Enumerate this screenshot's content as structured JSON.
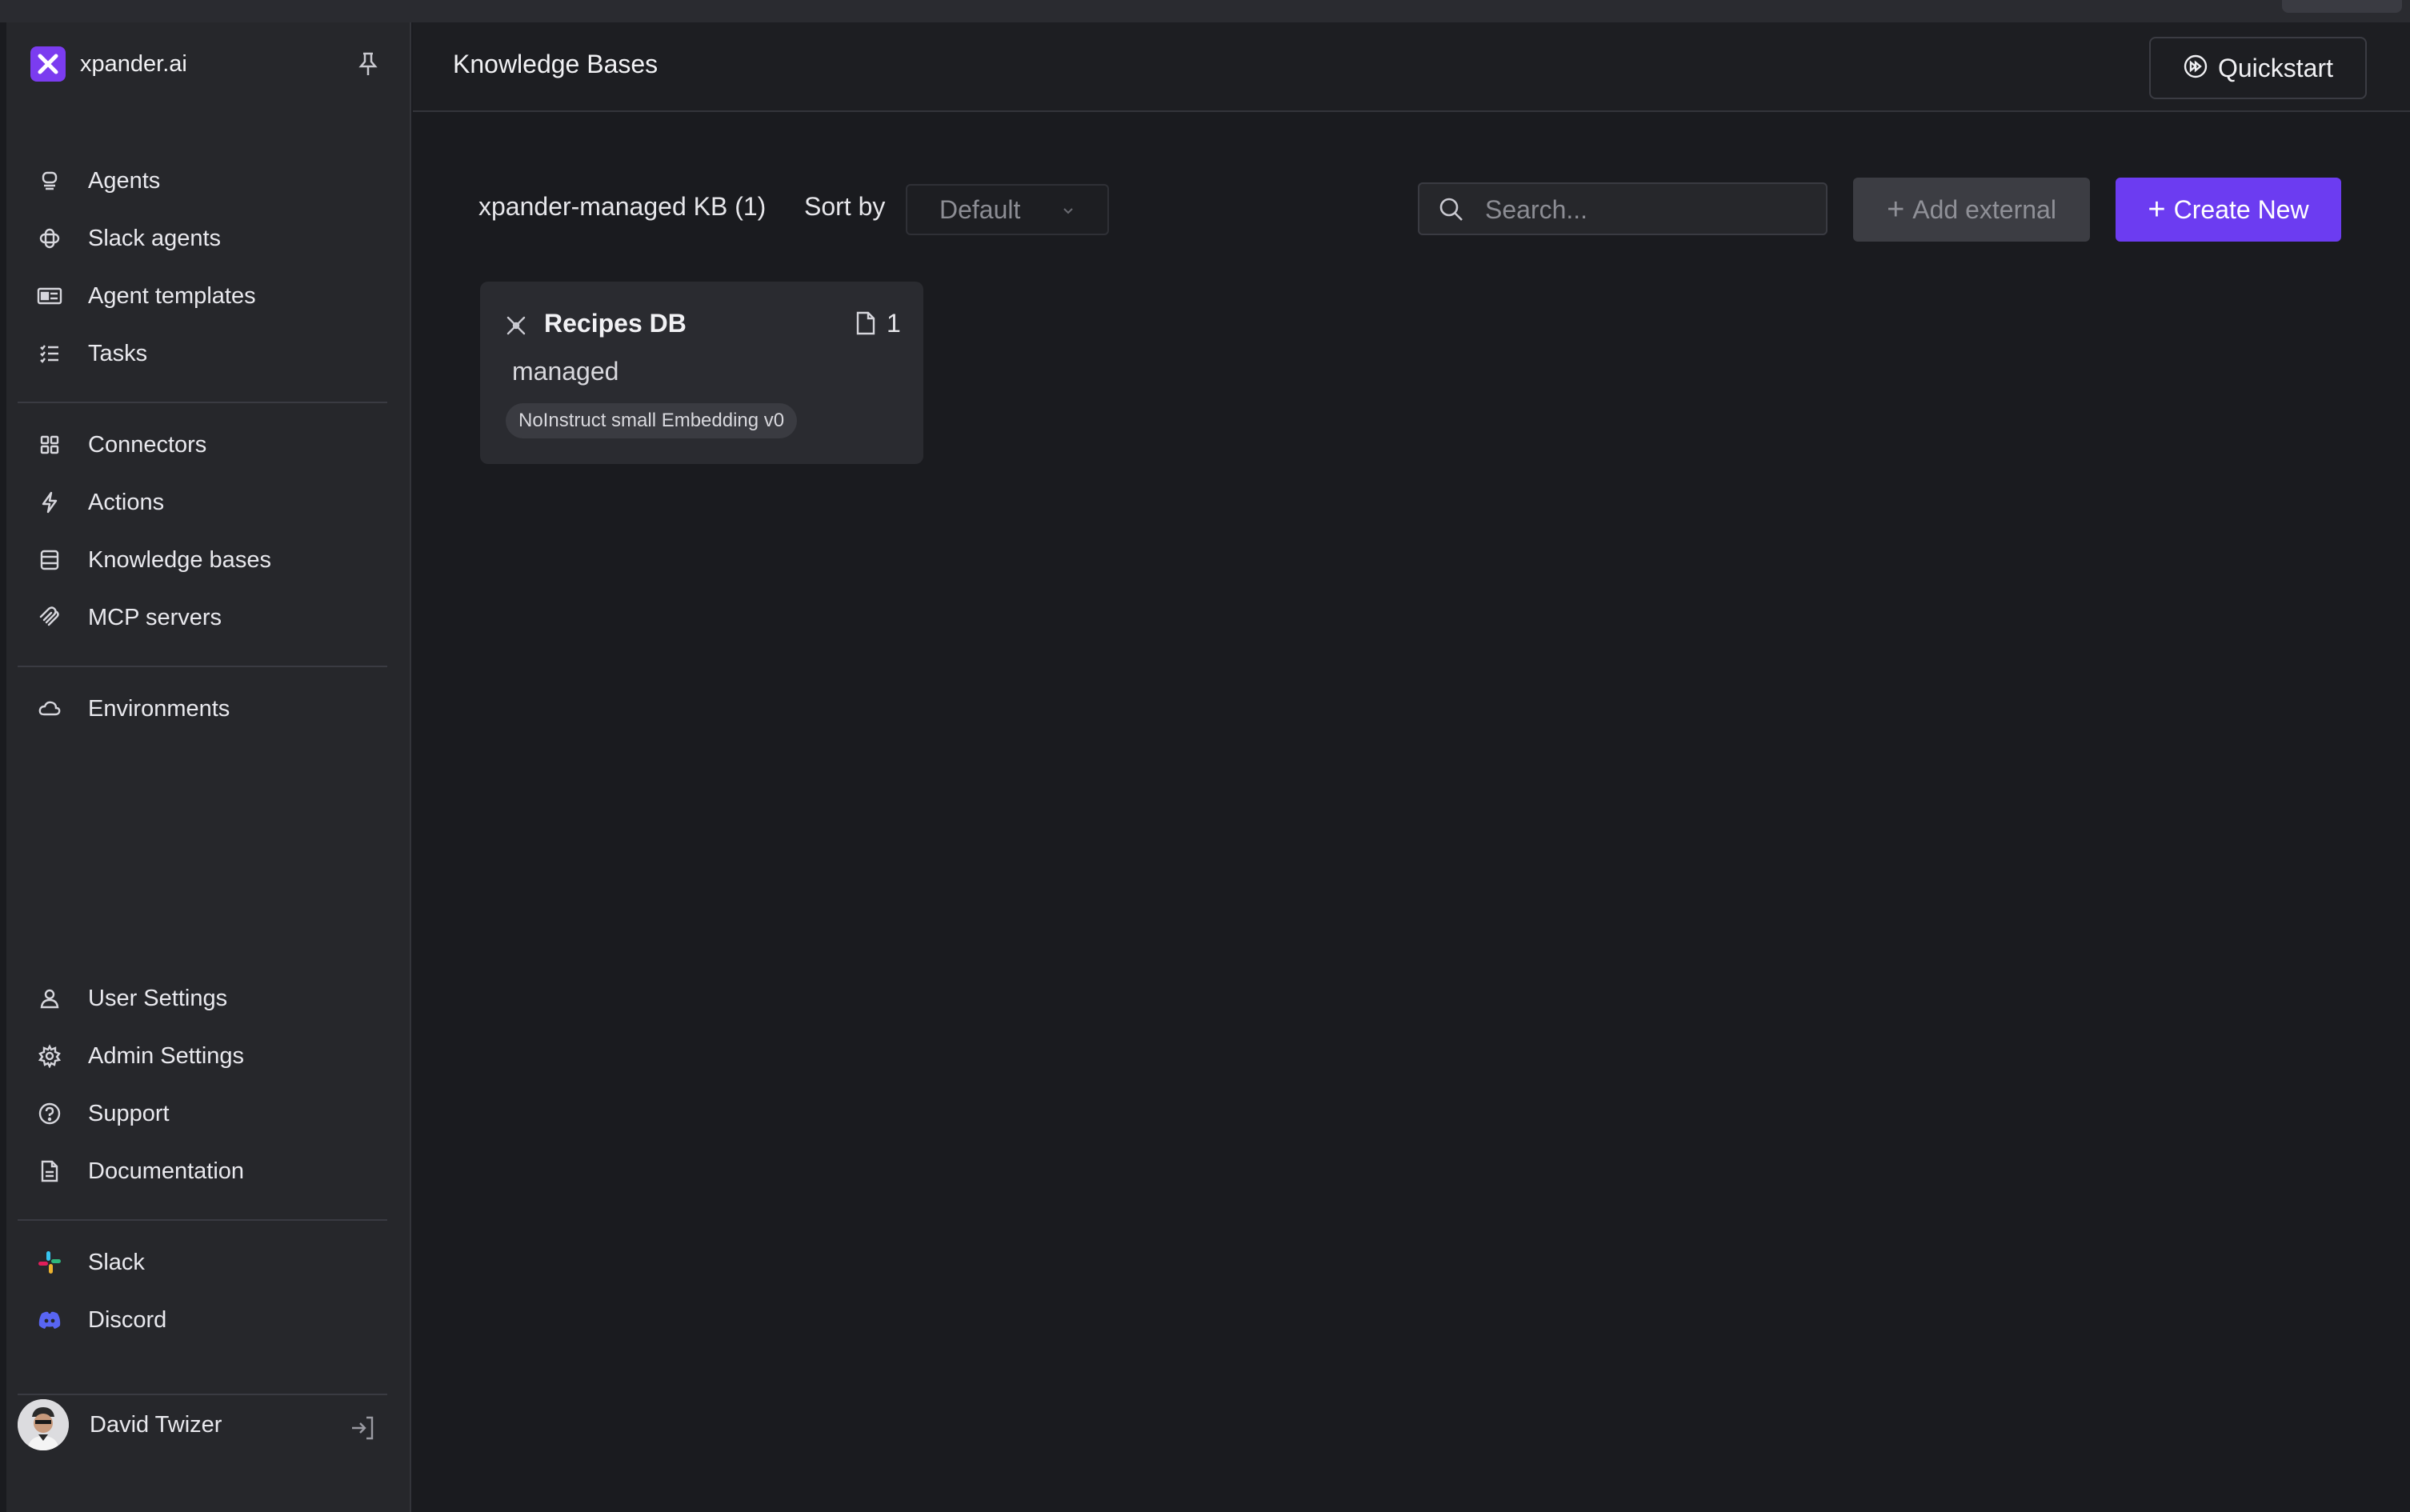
{
  "app": {
    "name": "xpander.ai",
    "accent": "#6c3cf1"
  },
  "sidebar": {
    "groups": [
      [
        {
          "label": "Agents",
          "icon": "agent-icon"
        },
        {
          "label": "Slack agents",
          "icon": "slack-agents-icon"
        },
        {
          "label": "Agent templates",
          "icon": "templates-icon"
        },
        {
          "label": "Tasks",
          "icon": "tasks-icon"
        }
      ],
      [
        {
          "label": "Connectors",
          "icon": "connectors-icon"
        },
        {
          "label": "Actions",
          "icon": "lightning-icon"
        },
        {
          "label": "Knowledge bases",
          "icon": "database-icon"
        },
        {
          "label": "MCP servers",
          "icon": "mcp-icon"
        }
      ],
      [
        {
          "label": "Environments",
          "icon": "cloud-icon"
        }
      ],
      [
        {
          "label": "User Settings",
          "icon": "user-icon"
        },
        {
          "label": "Admin Settings",
          "icon": "gear-icon"
        },
        {
          "label": "Support",
          "icon": "help-icon"
        },
        {
          "label": "Documentation",
          "icon": "document-icon"
        }
      ],
      [
        {
          "label": "Slack",
          "icon": "slack-icon"
        },
        {
          "label": "Discord",
          "icon": "discord-icon"
        }
      ]
    ],
    "user": {
      "name": "David Twizer"
    }
  },
  "header": {
    "title": "Knowledge Bases",
    "quickstart_label": "Quickstart"
  },
  "toolbar": {
    "kb_count_label": "xpander-managed KB (1)",
    "sort_label": "Sort by",
    "sort_value": "Default",
    "search_placeholder": "Search...",
    "add_external_label": "Add external",
    "create_new_label": "Create New"
  },
  "cards": [
    {
      "name": "Recipes DB",
      "file_count": "1",
      "type": "managed",
      "embedding": "NoInstruct small Embedding v0"
    }
  ]
}
